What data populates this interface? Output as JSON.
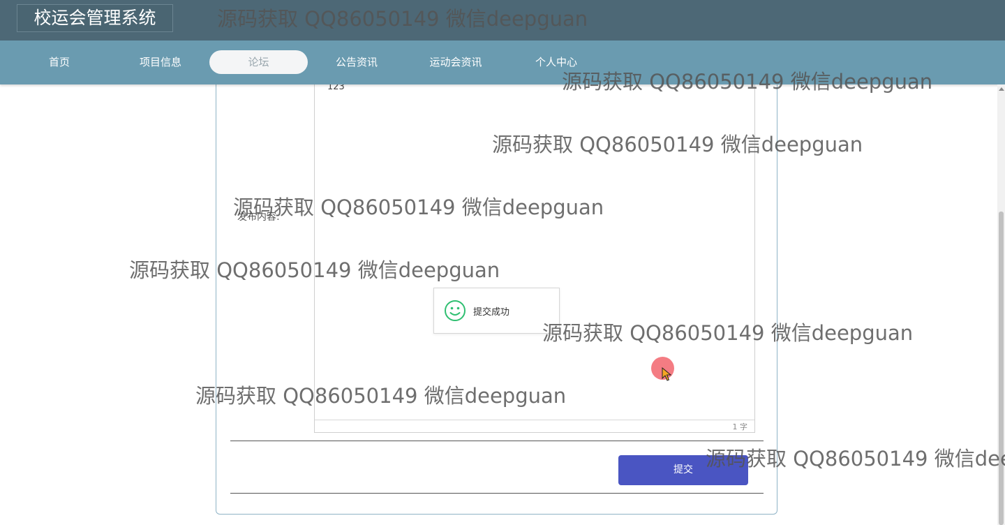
{
  "header": {
    "title": "校运会管理系统"
  },
  "nav": {
    "items": [
      {
        "label": "首页"
      },
      {
        "label": "项目信息"
      },
      {
        "label": "论坛",
        "active": true
      },
      {
        "label": "公告资讯"
      },
      {
        "label": "运动会资讯"
      },
      {
        "label": "个人中心"
      }
    ]
  },
  "form": {
    "content_label": "发布内容:",
    "editor_value": "123",
    "word_count": "1 字",
    "submit_label": "提交"
  },
  "toast": {
    "message": "提交成功",
    "icon": "smile-icon"
  },
  "watermark": {
    "text": "源码获取 QQ86050149 微信deepguan"
  },
  "colors": {
    "header_bg": "#4d6876",
    "nav_bg": "#6a9bb0",
    "submit_bg": "#4a55c2",
    "toast_icon": "#2fbf71"
  }
}
